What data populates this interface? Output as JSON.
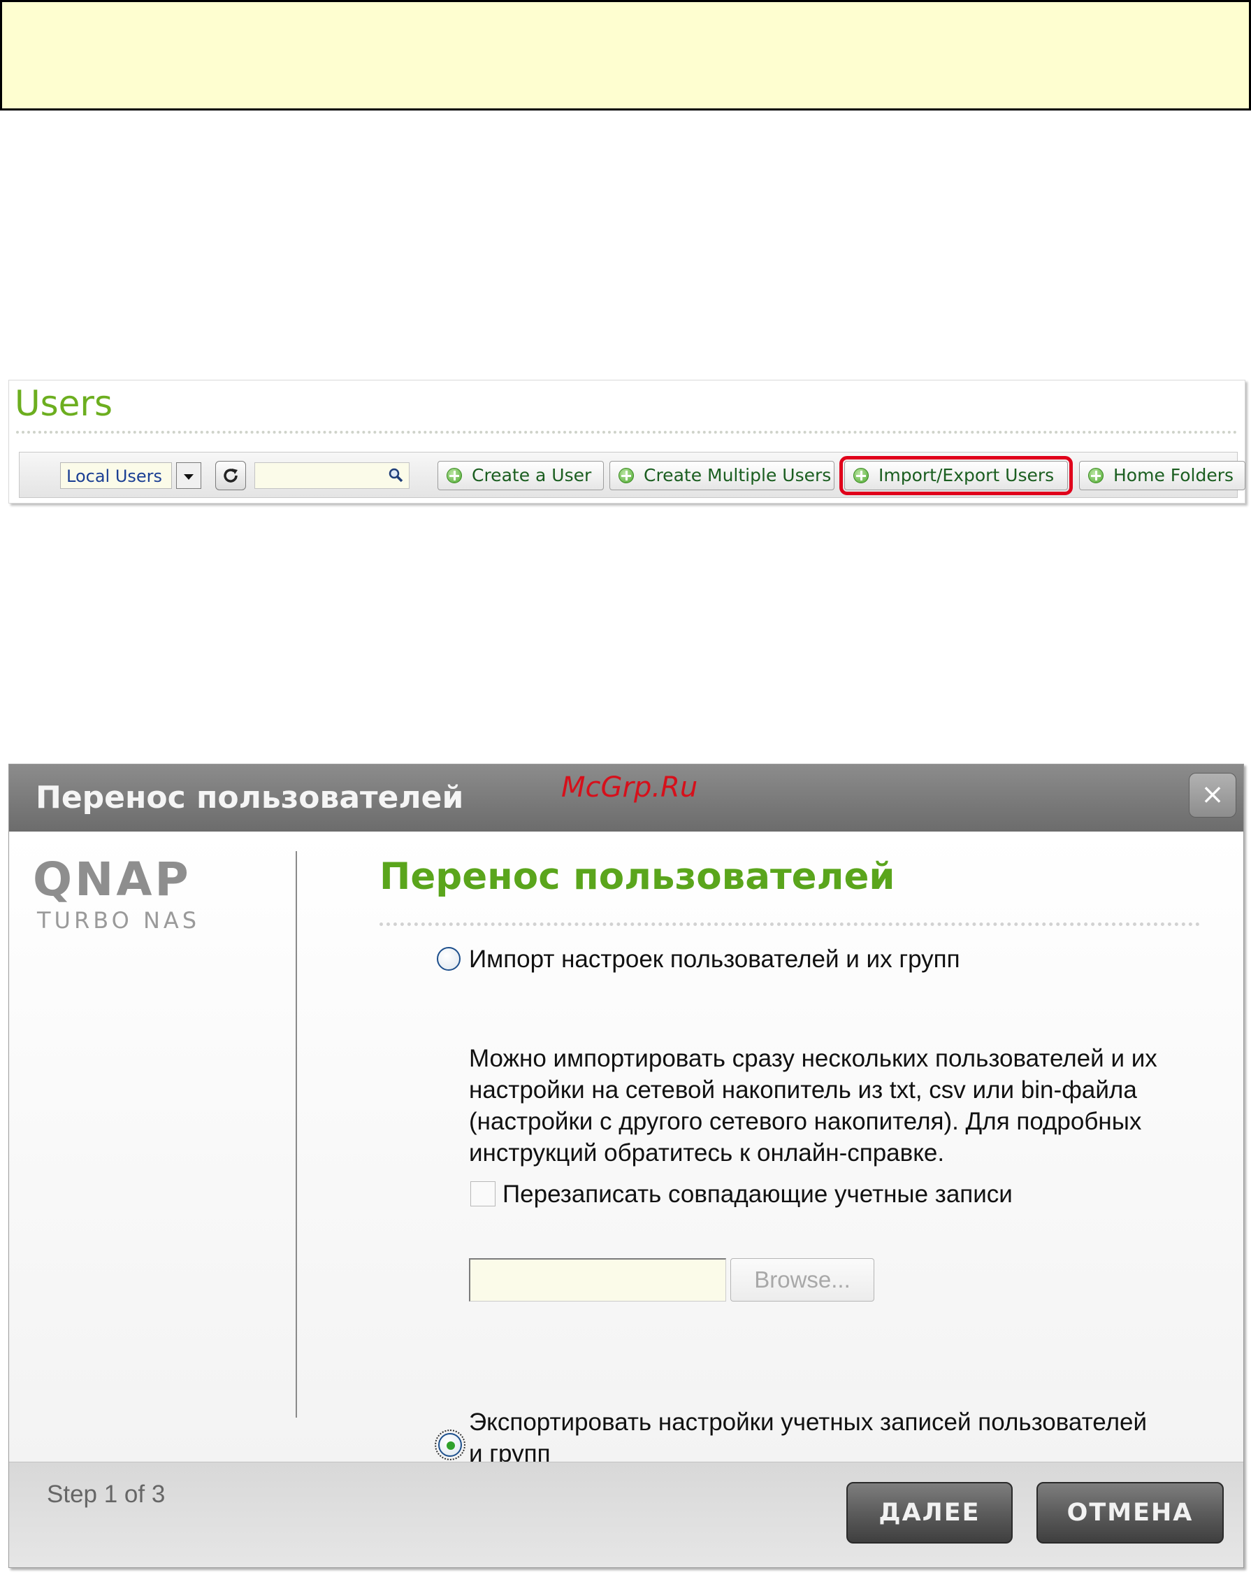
{
  "users_panel": {
    "title": "Users",
    "user_scope_select": "Local Users",
    "buttons": {
      "create_user": "Create a User",
      "create_multiple": "Create Multiple Users",
      "import_export": "Import/Export Users",
      "home_folders": "Home Folders"
    },
    "highlight_color": "#e0001b"
  },
  "dialog": {
    "title": "Перенос пользователей",
    "watermark": "McGrp.Ru",
    "close_label": "×",
    "logo": {
      "main": "QNAP",
      "sub": "TURBO NAS"
    },
    "heading": "Перенос пользователей",
    "import_option": {
      "label": "Импорт настроек пользователей и их групп",
      "selected": false,
      "description_lines": [
        "Можно импортировать сразу нескольких пользователей и их",
        "настройки на сетевой накопитель из txt, csv или bin-файла",
        "(настройки с другого сетевого накопителя). Для подробных",
        "инструкций обратитесь к онлайн-справке."
      ],
      "overwrite_checkbox_label": "Перезаписать совпадающие учетные записи",
      "overwrite_checked": false,
      "file_value": "",
      "browse_label": "Browse..."
    },
    "export_option": {
      "label_lines": [
        "Экспортировать настройки учетных записей пользователей",
        "и групп"
      ],
      "selected": true
    },
    "footer": {
      "step": "Step 1 of 3",
      "next_label": "ДАЛЕЕ",
      "cancel_label": "ОТМЕНА"
    },
    "colors": {
      "heading": "#5aa51c",
      "titlebar": "#7a7a7a"
    }
  }
}
